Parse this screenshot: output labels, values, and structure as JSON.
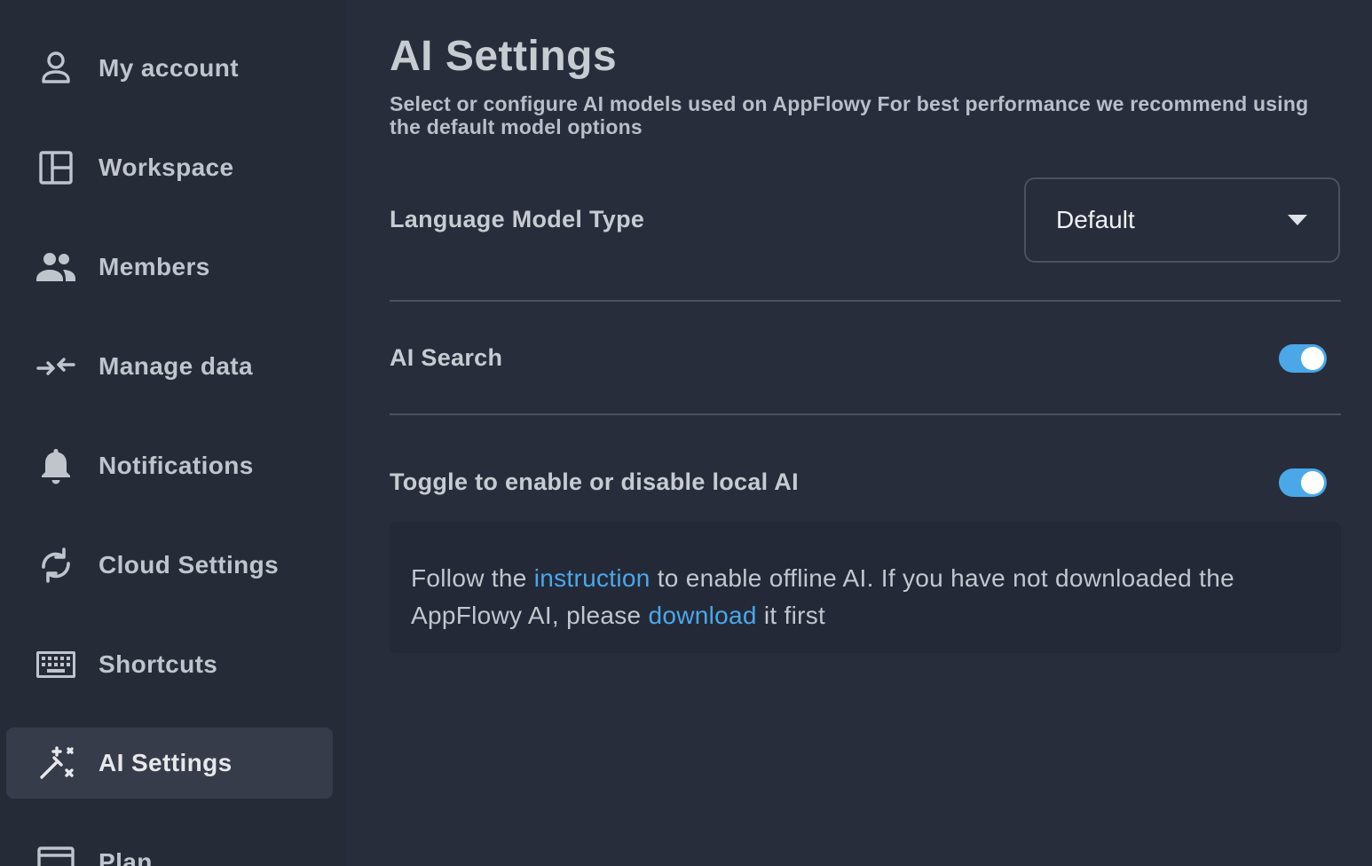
{
  "sidebar": {
    "items": [
      {
        "label": "My account",
        "icon": "person-icon",
        "active": false
      },
      {
        "label": "Workspace",
        "icon": "workspace-layout-icon",
        "active": false
      },
      {
        "label": "Members",
        "icon": "people-icon",
        "active": false
      },
      {
        "label": "Manage data",
        "icon": "arrows-inward-icon",
        "active": false
      },
      {
        "label": "Notifications",
        "icon": "bell-icon",
        "active": false
      },
      {
        "label": "Cloud Settings",
        "icon": "sync-icon",
        "active": false
      },
      {
        "label": "Shortcuts",
        "icon": "keyboard-icon",
        "active": false
      },
      {
        "label": "AI Settings",
        "icon": "magic-wand-icon",
        "active": true
      },
      {
        "label": "Plan",
        "icon": "plan-icon",
        "active": false
      }
    ]
  },
  "main": {
    "title": "AI Settings",
    "description": "Select or configure AI models used on AppFlowy For best performance we recommend using the default model options",
    "language_model": {
      "label": "Language Model Type",
      "value": "Default"
    },
    "ai_search": {
      "label": "AI Search",
      "enabled": true
    },
    "local_ai": {
      "label": "Toggle to enable or disable local AI",
      "enabled": true
    },
    "info": {
      "part1": "Follow the ",
      "link1": "instruction",
      "part2": " to enable offline AI. If you have not downloaded the AppFlowy AI, please ",
      "link2": "download",
      "part3": " it first"
    }
  },
  "colors": {
    "background": "#282d3b",
    "sidebar": "#262b38",
    "active_item": "#363c4a",
    "accent": "#4aa8e8"
  }
}
